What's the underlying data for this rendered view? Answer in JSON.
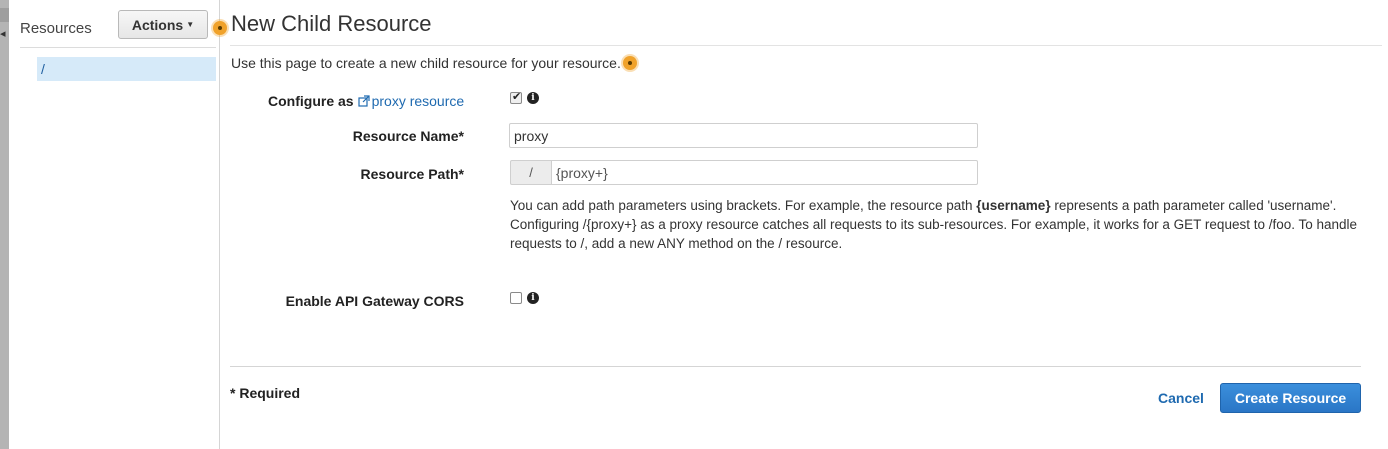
{
  "sidebar": {
    "title": "Resources",
    "actions_label": "Actions",
    "actions_caret": "▼",
    "tree": [
      {
        "label": "/"
      }
    ]
  },
  "main": {
    "title": "New Child Resource",
    "intro": "Use this page to create a new child resource for your resource.",
    "configure_label": "Configure as",
    "proxy_link": "proxy resource",
    "proxy_checked": true,
    "resource_name_label": "Resource Name*",
    "resource_name_value": "proxy",
    "resource_path_label": "Resource Path*",
    "resource_path_prefix": "/",
    "resource_path_value": "{proxy+}",
    "help": {
      "part1": "You can add path parameters using brackets. For example, the resource path ",
      "bold": "{username}",
      "part2": " represents a path parameter called 'username'. Configuring /{proxy+} as a proxy resource catches all requests to its sub-resources. For example, it works for a GET request to /foo. To handle requests to /, add a new ANY method on the / resource."
    },
    "cors_label": "Enable API Gateway CORS",
    "cors_checked": false
  },
  "footer": {
    "required_note": "* Required",
    "cancel_label": "Cancel",
    "create_label": "Create Resource"
  },
  "icons": {
    "info": "info-icon",
    "external_link": "external-link-icon",
    "hotspot": "hotspot-marker-icon"
  },
  "colors": {
    "accent": "#2a76c6",
    "link": "#1f6ab0",
    "selected_row": "#d6eaf9",
    "hotspot": "#f0a22b"
  }
}
